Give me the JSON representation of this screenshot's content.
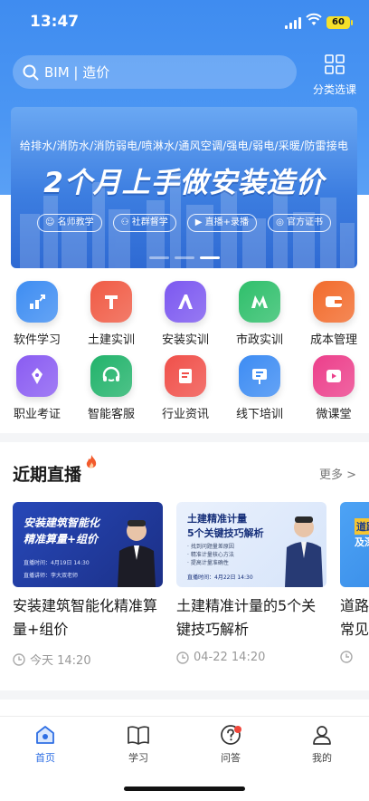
{
  "status_bar": {
    "time": "13:47",
    "battery": "60"
  },
  "search": {
    "placeholder": "BIM | 造价"
  },
  "category": {
    "label": "分类选课"
  },
  "banner": {
    "subtitle": "给排水/消防水/消防弱电/喷淋水/通风空调/强电/弱电/采暖/防雷接电",
    "title": "2个月上手做安装造价",
    "tags": [
      "名师教学",
      "社群督学",
      "直播+录播",
      "官方证书"
    ],
    "slide_count": 3,
    "active_slide": 3
  },
  "grid": [
    {
      "label": "软件学习",
      "icon": "chart-icon",
      "color": "#3e8df2"
    },
    {
      "label": "土建实训",
      "icon": "letter-t-icon",
      "color": "#f05b45"
    },
    {
      "label": "安装实训",
      "icon": "letter-a-icon",
      "color": "#7c58f0"
    },
    {
      "label": "市政实训",
      "icon": "letter-m-icon",
      "color": "#2fbf6b"
    },
    {
      "label": "成本管理",
      "icon": "card-icon",
      "color": "#f26b2c"
    },
    {
      "label": "职业考证",
      "icon": "pen-icon",
      "color": "#8a5cf2"
    },
    {
      "label": "智能客服",
      "icon": "headset-icon",
      "color": "#22b36b"
    },
    {
      "label": "行业资讯",
      "icon": "news-icon",
      "color": "#f0504a"
    },
    {
      "label": "线下培训",
      "icon": "board-icon",
      "color": "#3d8cf3"
    },
    {
      "label": "微课堂",
      "icon": "play-icon",
      "color": "#ec3f8b"
    }
  ],
  "live": {
    "title": "近期直播",
    "more": "更多 >",
    "cards": [
      {
        "thumb_title_1": "安装建筑智能化",
        "thumb_title_2": "精准算量+组价",
        "thumb_time": "直播时间：4月19日 14:30",
        "thumb_teacher": "直播讲师：李大双老师",
        "title": "安装建筑智能化精准算量+组价",
        "time": "今天 14:20"
      },
      {
        "thumb_title_1": "土建精准计量",
        "thumb_title_2": "5个关键技巧解析",
        "thumb_points": [
          "· 找到问题量差原因",
          "· 精准计量核心方法",
          "· 提高计量准确性"
        ],
        "thumb_time": "直播时间：4月22日 14:30",
        "title": "土建精准计量的5个关键技巧解析",
        "time": "04-22 14:20"
      },
      {
        "thumb_title_1": "道路",
        "thumb_title_2": "及深",
        "title": "道路常见",
        "time": ""
      }
    ]
  },
  "tabbar": [
    {
      "label": "首页",
      "icon": "home-icon",
      "active": true
    },
    {
      "label": "学习",
      "icon": "book-icon",
      "active": false
    },
    {
      "label": "问答",
      "icon": "question-icon",
      "active": false,
      "badge": true
    },
    {
      "label": "我的",
      "icon": "user-icon",
      "active": false
    }
  ],
  "colors": {
    "brand": "#3f8cf0",
    "active_tab": "#2f6fe4",
    "badge": "#f0463a"
  }
}
